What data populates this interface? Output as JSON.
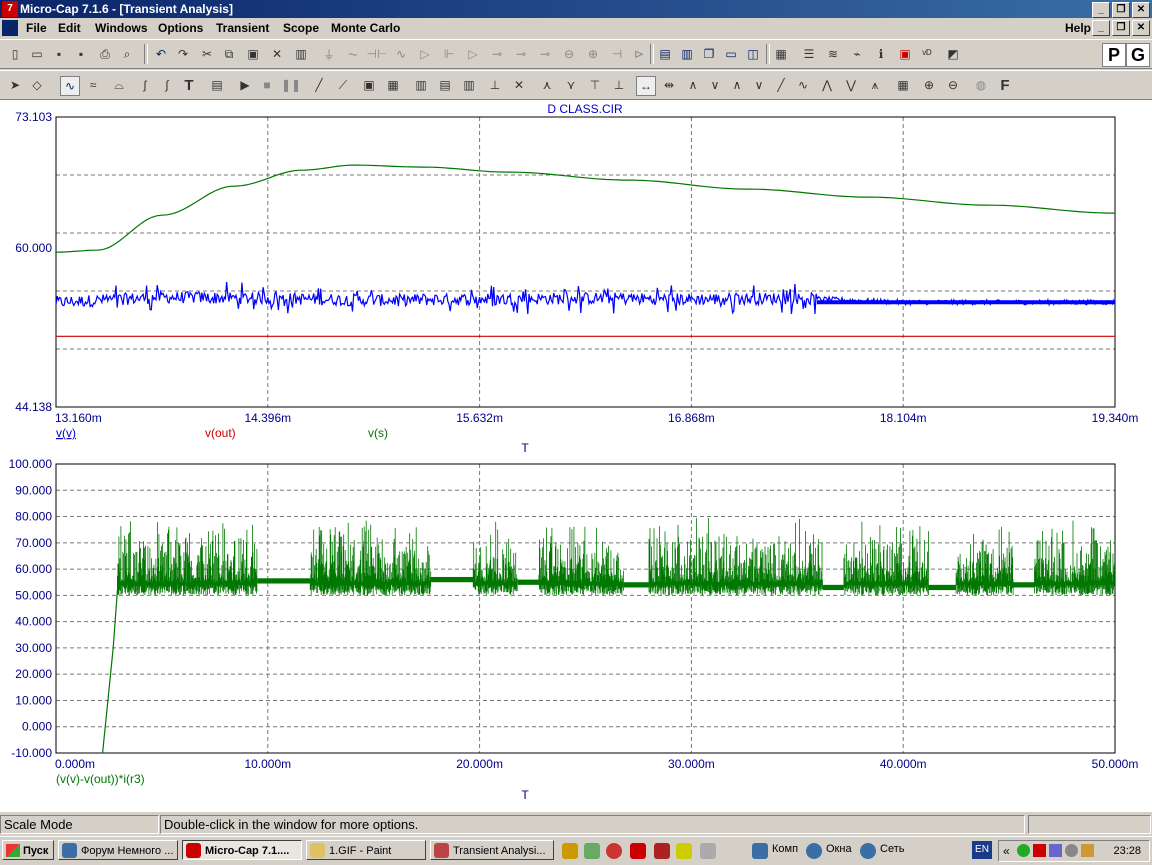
{
  "window": {
    "title": "Micro-Cap 7.1.6 - [Transient Analysis]"
  },
  "menu": [
    "File",
    "Edit",
    "Windows",
    "Options",
    "Transient",
    "Scope",
    "Monte Carlo"
  ],
  "menu_help": "Help",
  "toolbar_right": {
    "p": "P",
    "g": "G"
  },
  "chart_data": [
    {
      "type": "line",
      "title": "D CLASS.CIR",
      "xlabel": "T",
      "x_ticks": [
        "13.160m",
        "14.396m",
        "15.632m",
        "16.868m",
        "18.104m",
        "19.340m"
      ],
      "y_ticks": [
        "73.103",
        "60.000",
        "44.138"
      ],
      "xlim": [
        0.01316,
        0.01934
      ],
      "ylim": [
        44.138,
        73.103
      ],
      "grid": true,
      "series": [
        {
          "name": "v(v)",
          "color": "#0000ff",
          "x": [
            0.01316,
            0.01378,
            0.0144,
            0.01502,
            0.01563,
            0.01625,
            0.01687,
            0.01749,
            0.0181,
            0.01872,
            0.01934
          ],
          "values": [
            54.6,
            55.1,
            55.0,
            54.8,
            54.9,
            55.0,
            54.9,
            55.0,
            54.6,
            54.6,
            54.6
          ]
        },
        {
          "name": "v(out)",
          "color": "#cc0000",
          "x": [
            0.01316,
            0.01934
          ],
          "values": [
            51.2,
            51.2
          ]
        },
        {
          "name": "v(s)",
          "color": "#007700",
          "x": [
            0.01316,
            0.0134,
            0.01378,
            0.0142,
            0.0146,
            0.0149,
            0.0153,
            0.0158,
            0.0165,
            0.0172,
            0.0179,
            0.0186,
            0.01934
          ],
          "values": [
            59.6,
            59.8,
            63.3,
            66.2,
            67.8,
            68.3,
            68.1,
            67.6,
            66.8,
            65.9,
            65.1,
            64.3,
            63.5
          ]
        }
      ]
    },
    {
      "type": "line",
      "xlabel": "T",
      "series_label": "(v(v)-v(out))*i(r3)",
      "x_ticks": [
        "0.000m",
        "10.000m",
        "20.000m",
        "30.000m",
        "40.000m",
        "50.000m"
      ],
      "y_ticks": [
        "100.000",
        "90.000",
        "80.000",
        "70.000",
        "60.000",
        "50.000",
        "40.000",
        "30.000",
        "20.000",
        "10.000",
        "0.000",
        "-10.000"
      ],
      "xlim": [
        0,
        0.05
      ],
      "ylim": [
        -10,
        100
      ],
      "grid": true,
      "series": [
        {
          "name": "(v(v)-v(out))*i(r3)",
          "color": "#007700",
          "segments": [
            {
              "x0": 0.0029,
              "x1": 0.0095,
              "mode": "burst"
            },
            {
              "x0": 0.0095,
              "x1": 0.012,
              "mode": "flat",
              "level": 55.5
            },
            {
              "x0": 0.012,
              "x1": 0.0177,
              "mode": "burst"
            },
            {
              "x0": 0.0177,
              "x1": 0.0197,
              "mode": "flat",
              "level": 56
            },
            {
              "x0": 0.0197,
              "x1": 0.0218,
              "mode": "burst"
            },
            {
              "x0": 0.0218,
              "x1": 0.0228,
              "mode": "flat",
              "level": 55
            },
            {
              "x0": 0.0228,
              "x1": 0.0268,
              "mode": "burst"
            },
            {
              "x0": 0.0268,
              "x1": 0.028,
              "mode": "flat",
              "level": 54
            },
            {
              "x0": 0.028,
              "x1": 0.0362,
              "mode": "burst"
            },
            {
              "x0": 0.0362,
              "x1": 0.0372,
              "mode": "flat",
              "level": 53
            },
            {
              "x0": 0.0372,
              "x1": 0.0412,
              "mode": "burst"
            },
            {
              "x0": 0.0412,
              "x1": 0.0425,
              "mode": "flat",
              "level": 53
            },
            {
              "x0": 0.0425,
              "x1": 0.0452,
              "mode": "burst"
            },
            {
              "x0": 0.0452,
              "x1": 0.0462,
              "mode": "flat",
              "level": 54
            },
            {
              "x0": 0.0462,
              "x1": 0.05,
              "mode": "burst"
            }
          ]
        }
      ]
    }
  ],
  "status": {
    "mode": "Scale Mode",
    "hint": "Double-click in the window for more options."
  },
  "taskbar": {
    "start": "Пуск",
    "tasks": [
      "Форум Немного ...",
      "Micro-Cap 7.1....",
      "1.GIF - Paint",
      "Transient Analysi..."
    ],
    "quicklinks": [
      "Комп",
      "Окна",
      "Сеть"
    ],
    "lang": "EN",
    "clock": "23:28"
  },
  "colors": {
    "accent": "#0a246a",
    "axis_text": "#00008b"
  }
}
